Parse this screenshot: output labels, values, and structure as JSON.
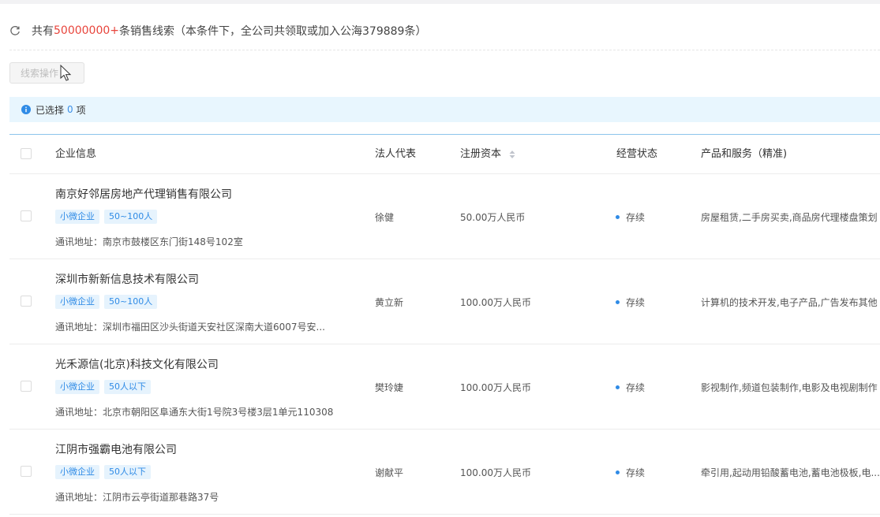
{
  "summary": {
    "prefix": "共有",
    "count": "50000000+",
    "suffix": "条销售线索（本条件下，全公司共领取或加入公海379889条）"
  },
  "toolbar": {
    "lead_actions_label": "线索操作"
  },
  "selection": {
    "prefix": "已选择",
    "count": "0",
    "suffix": "项"
  },
  "table": {
    "columns": {
      "company": "企业信息",
      "legal_rep": "法人代表",
      "capital": "注册资本",
      "status": "经营状态",
      "products": "产品和服务（精准)"
    },
    "rows": [
      {
        "name": "南京好邻居房地产代理销售有限公司",
        "tag1": "小微企业",
        "tag2": "50~100人",
        "address_label": "通讯地址：",
        "address": "南京市鼓楼区东门街148号102室",
        "legal_rep": "徐健",
        "capital": "50.00万人民币",
        "status": "存续",
        "products": "房屋租赁,二手房买卖,商品房代理楼盘策划"
      },
      {
        "name": "深圳市新新信息技术有限公司",
        "tag1": "小微企业",
        "tag2": "50~100人",
        "address_label": "通讯地址：",
        "address": "深圳市福田区沙头街道天安社区深南大道6007号安...",
        "legal_rep": "黄立新",
        "capital": "100.00万人民币",
        "status": "存续",
        "products": "计算机的技术开发,电子产品,广告发布其他"
      },
      {
        "name": "光禾源信(北京)科技文化有限公司",
        "tag1": "小微企业",
        "tag2": "50人以下",
        "address_label": "通讯地址：",
        "address": "北京市朝阳区阜通东大街1号院3号楼3层1单元110308",
        "legal_rep": "樊玲婕",
        "capital": "100.00万人民币",
        "status": "存续",
        "products": "影视制作,频道包装制作,电影及电视剧制作"
      },
      {
        "name": "江阴市强霸电池有限公司",
        "tag1": "小微企业",
        "tag2": "50人以下",
        "address_label": "通讯地址：",
        "address": "江阴市云亭街道那巷路37号",
        "legal_rep": "谢献平",
        "capital": "100.00万人民币",
        "status": "存续",
        "products": "牵引用,起动用铅酸蓄电池,蓄电池极板,电..."
      }
    ]
  }
}
